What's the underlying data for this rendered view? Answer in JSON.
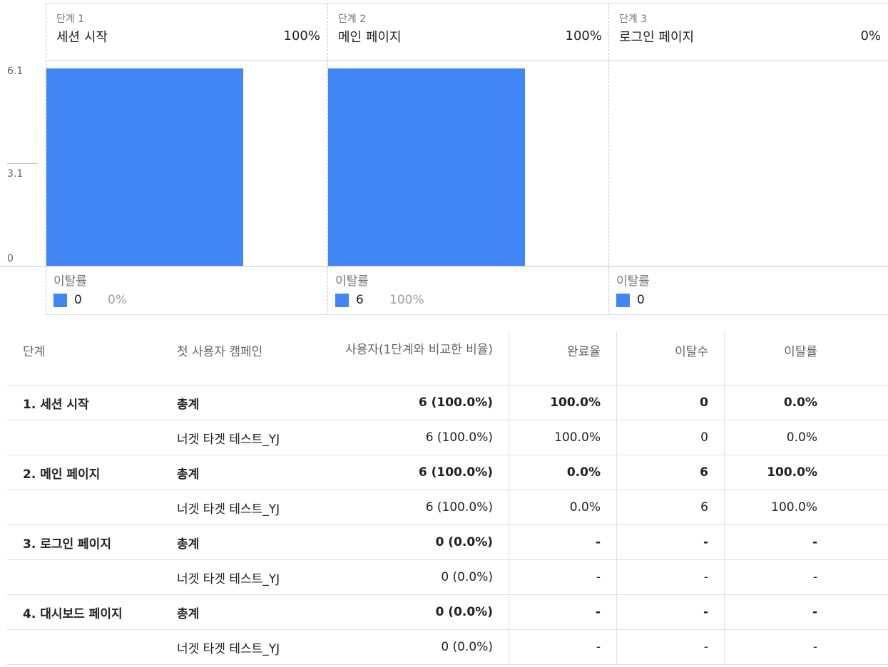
{
  "chart_data": {
    "type": "bar",
    "y_ticks": [
      "6.1",
      "3.1",
      "0"
    ],
    "ylim": [
      0,
      6.1
    ],
    "steps": [
      {
        "number": "단계 1",
        "name": "세션 시작",
        "percent": "100%",
        "value": 6,
        "dropoff_label": "이탈률",
        "dropoff_count": "0",
        "dropoff_rate": "0%"
      },
      {
        "number": "단계 2",
        "name": "메인 페이지",
        "percent": "100%",
        "value": 6,
        "dropoff_label": "이탈률",
        "dropoff_count": "6",
        "dropoff_rate": "100%"
      },
      {
        "number": "단계 3",
        "name": "로그인 페이지",
        "percent": "0%",
        "value": 0,
        "dropoff_label": "이탈률",
        "dropoff_count": "0",
        "dropoff_rate": ""
      }
    ],
    "bar_color": "#4285f4"
  },
  "table": {
    "headers": [
      "단계",
      "첫 사용자 캠페인",
      "사용자(1단계와 비교한 비율)",
      "완료율",
      "이탈수",
      "이탈률"
    ],
    "rows": [
      {
        "bold": true,
        "cells": [
          "1. 세션 시작",
          "총계",
          "6 (100.0%)",
          "100.0%",
          "0",
          "0.0%"
        ]
      },
      {
        "bold": false,
        "cells": [
          "",
          "너겟 타겟 테스트_YJ",
          "6 (100.0%)",
          "100.0%",
          "0",
          "0.0%"
        ]
      },
      {
        "bold": true,
        "cells": [
          "2. 메인 페이지",
          "총계",
          "6 (100.0%)",
          "0.0%",
          "6",
          "100.0%"
        ]
      },
      {
        "bold": false,
        "cells": [
          "",
          "너겟 타겟 테스트_YJ",
          "6 (100.0%)",
          "0.0%",
          "6",
          "100.0%"
        ]
      },
      {
        "bold": true,
        "cells": [
          "3. 로그인 페이지",
          "총계",
          "0 (0.0%)",
          "-",
          "-",
          "-"
        ]
      },
      {
        "bold": false,
        "cells": [
          "",
          "너겟 타겟 테스트_YJ",
          "0 (0.0%)",
          "-",
          "-",
          "-"
        ]
      },
      {
        "bold": true,
        "cells": [
          "4. 대시보드 페이지",
          "총계",
          "0 (0.0%)",
          "-",
          "-",
          "-"
        ]
      },
      {
        "bold": false,
        "cells": [
          "",
          "너겟 타겟 테스트_YJ",
          "0 (0.0%)",
          "-",
          "-",
          "-"
        ]
      }
    ]
  }
}
